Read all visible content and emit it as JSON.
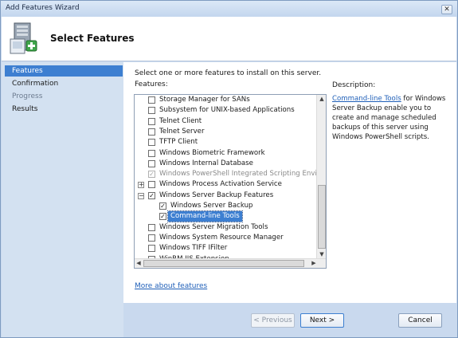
{
  "window": {
    "title": "Add Features Wizard",
    "close_glyph": "✕"
  },
  "header": {
    "heading": "Select Features",
    "icon": "server-install-icon"
  },
  "nav": {
    "items": [
      {
        "label": "Features",
        "state": "active"
      },
      {
        "label": "Confirmation",
        "state": "normal"
      },
      {
        "label": "Progress",
        "state": "disabled"
      },
      {
        "label": "Results",
        "state": "normal"
      }
    ]
  },
  "content": {
    "intro": "Select one or more features to install on this server.",
    "features_label": "Features:",
    "features": [
      {
        "label": "Storage Manager for SANs",
        "checked": false,
        "level": 0,
        "expander": "",
        "state": "normal"
      },
      {
        "label": "Subsystem for UNIX-based Applications",
        "checked": false,
        "level": 0,
        "expander": "",
        "state": "normal"
      },
      {
        "label": "Telnet Client",
        "checked": false,
        "level": 0,
        "expander": "",
        "state": "normal"
      },
      {
        "label": "Telnet Server",
        "checked": false,
        "level": 0,
        "expander": "",
        "state": "normal"
      },
      {
        "label": "TFTP Client",
        "checked": false,
        "level": 0,
        "expander": "",
        "state": "normal"
      },
      {
        "label": "Windows Biometric Framework",
        "checked": false,
        "level": 0,
        "expander": "",
        "state": "normal"
      },
      {
        "label": "Windows Internal Database",
        "checked": false,
        "level": 0,
        "expander": "",
        "state": "normal"
      },
      {
        "label": "Windows PowerShell Integrated Scripting Environr",
        "checked": true,
        "level": 0,
        "expander": "",
        "state": "disabled"
      },
      {
        "label": "Windows Process Activation Service",
        "checked": false,
        "level": 0,
        "expander": "+",
        "state": "normal"
      },
      {
        "label": "Windows Server Backup Features",
        "checked": true,
        "level": 0,
        "expander": "−",
        "state": "normal"
      },
      {
        "label": "Windows Server Backup",
        "checked": true,
        "level": 1,
        "expander": "",
        "state": "normal"
      },
      {
        "label": "Command-line Tools",
        "checked": true,
        "level": 1,
        "expander": "",
        "state": "selected"
      },
      {
        "label": "Windows Server Migration Tools",
        "checked": false,
        "level": 0,
        "expander": "",
        "state": "normal"
      },
      {
        "label": "Windows System Resource Manager",
        "checked": false,
        "level": 0,
        "expander": "",
        "state": "normal"
      },
      {
        "label": "Windows TIFF IFilter",
        "checked": false,
        "level": 0,
        "expander": "",
        "state": "normal"
      },
      {
        "label": "WinRM IIS Extension",
        "checked": false,
        "level": 0,
        "expander": "",
        "state": "normal"
      }
    ],
    "check_glyph": "✓",
    "description_title": "Description:",
    "description_link": "Command-line Tools",
    "description_text": " for Windows Server Backup enable you to create and manage scheduled backups of this server using Windows PowerShell scripts.",
    "more_link": "More about features",
    "scroll": {
      "up": "▲",
      "down": "▼",
      "left": "◀",
      "right": "▶"
    }
  },
  "footer": {
    "previous_label": "< Previous",
    "next_label": "Next >",
    "cancel_label": "Cancel"
  }
}
